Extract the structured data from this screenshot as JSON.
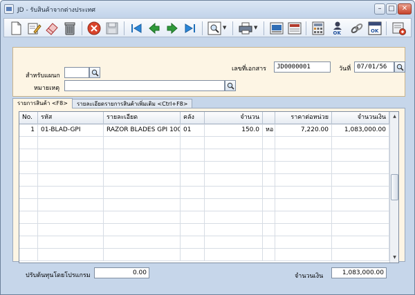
{
  "window": {
    "title": "JD - รับสินค้าจากต่างประเทศ",
    "min_label": "–",
    "max_label": "□",
    "close_label": "✕"
  },
  "toolbar": {
    "icons": [
      "new-icon",
      "edit-icon",
      "erase-icon",
      "delete-icon",
      "cancel-icon",
      "save-icon",
      "first-icon",
      "previous-icon",
      "next-icon",
      "last-icon",
      "find-icon",
      "print-icon",
      "preview-icon",
      "report-icon",
      "calculator-icon",
      "ok-user-icon",
      "link-icon",
      "ok-document-icon",
      "settings-icon"
    ]
  },
  "header": {
    "doc_no_label": "เลขที่เอกสาร",
    "doc_no_value": "JD0000001",
    "date_label": "วันที่",
    "date_value": "07/01/56",
    "department_label": "สำหรับแผนก",
    "department_value": "",
    "remark_label": "หมายเหตุ",
    "remark_value": ""
  },
  "tabs": [
    {
      "label": "รายการสินค้า <F8>"
    },
    {
      "label": "รายละเอียดรายการสินค้าเพิ่มเติม <Ctrl+F8>"
    }
  ],
  "grid": {
    "columns": [
      "No.",
      "รหัส",
      "รายละเอียด",
      "คลัง",
      "จำนวน",
      "",
      "ราคาต่อหน่วย",
      "จำนวนเงิน"
    ],
    "rows": [
      {
        "no": "1",
        "code": "01-BLAD-GPI",
        "desc": "RAZOR BLADES GPI 100",
        "wh": "01",
        "qty": "150.0",
        "unit": "หอ",
        "price": "7,220.00",
        "amount": "1,083,000.00"
      }
    ],
    "empty_rows": 10
  },
  "footer": {
    "adjust_label": "ปรับต้นทุนโดยโปรแกรม",
    "adjust_value": "0.00",
    "total_label": "จำนวนเงิน",
    "total_value": "1,083,000.00"
  }
}
